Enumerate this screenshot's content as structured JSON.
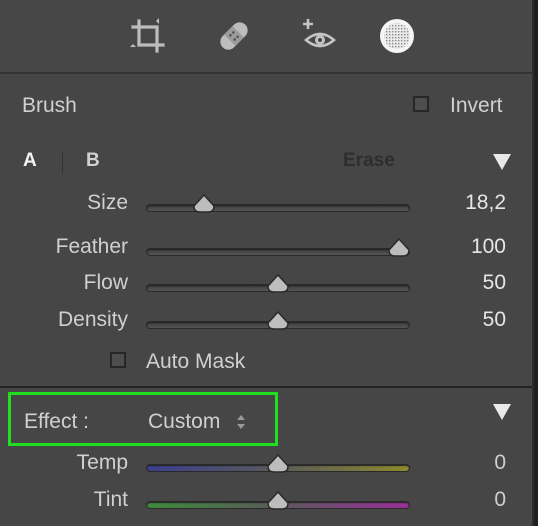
{
  "brush": {
    "title": "Brush",
    "invert_label": "Invert",
    "tab_a": "A",
    "tab_b": "B",
    "erase_label": "Erase",
    "auto_mask_label": "Auto Mask",
    "sliders": [
      {
        "label": "Size",
        "value": "18,2",
        "position": 0.22
      },
      {
        "label": "Feather",
        "value": "100",
        "position": 0.96
      },
      {
        "label": "Flow",
        "value": "50",
        "position": 0.5
      },
      {
        "label": "Density",
        "value": "50",
        "position": 0.5
      }
    ]
  },
  "effect": {
    "label": "Effect :",
    "value": "Custom",
    "highlight_color": "#1ee01e",
    "sliders": [
      {
        "label": "Temp",
        "value": "0",
        "position": 0.5
      },
      {
        "label": "Tint",
        "value": "0",
        "position": 0.5
      }
    ]
  },
  "toolbar": {
    "icons": [
      "crop-icon",
      "healing-bandage-icon",
      "red-eye-icon",
      "brush-mask-icon"
    ]
  }
}
